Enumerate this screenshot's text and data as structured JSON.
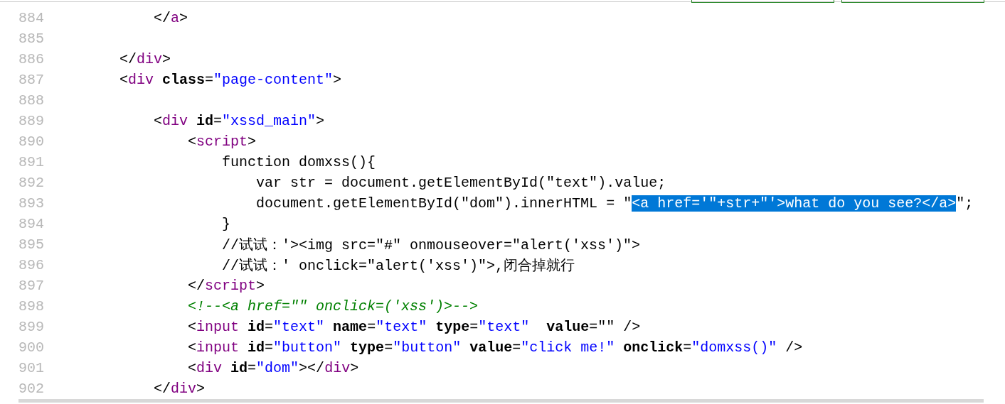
{
  "editor": {
    "lines": [
      {
        "number": "884",
        "tokens": [
          {
            "kind": "punct",
            "text": "            </"
          },
          {
            "kind": "tag",
            "text": "a"
          },
          {
            "kind": "punct",
            "text": ">"
          }
        ]
      },
      {
        "number": "885"
      },
      {
        "number": "886",
        "tokens": [
          {
            "kind": "punct",
            "text": "        </"
          },
          {
            "kind": "tag",
            "text": "div"
          },
          {
            "kind": "punct",
            "text": ">"
          }
        ]
      },
      {
        "number": "887",
        "tokens": [
          {
            "kind": "punct",
            "text": "        <"
          },
          {
            "kind": "tag",
            "text": "div"
          },
          {
            "kind": "attr",
            "text": " class"
          },
          {
            "kind": "punct",
            "text": "="
          },
          {
            "kind": "value",
            "text": "\"page-content\""
          },
          {
            "kind": "punct",
            "text": ">"
          }
        ]
      },
      {
        "number": "888"
      },
      {
        "number": "889",
        "tokens": [
          {
            "kind": "punct",
            "text": "            <"
          },
          {
            "kind": "tag",
            "text": "div"
          },
          {
            "kind": "attr",
            "text": " id"
          },
          {
            "kind": "punct",
            "text": "="
          },
          {
            "kind": "value",
            "text": "\"xssd_main\""
          },
          {
            "kind": "punct",
            "text": ">"
          }
        ]
      },
      {
        "number": "890",
        "tokens": [
          {
            "kind": "punct",
            "text": "                <"
          },
          {
            "kind": "tag",
            "text": "script"
          },
          {
            "kind": "punct",
            "text": ">"
          }
        ]
      },
      {
        "number": "891",
        "tokens": [
          {
            "kind": "text",
            "text": "                    function domxss(){"
          }
        ]
      },
      {
        "number": "892",
        "tokens": [
          {
            "kind": "text",
            "text": "                        var str = document.getElementById(\"text\").value;"
          }
        ]
      },
      {
        "number": "893",
        "tokens": [
          {
            "kind": "text",
            "text": "                        document.getElementById(\"dom\").innerHTML = \""
          },
          {
            "kind": "selection",
            "text": "<a href='\"+str+\"'>what do you see?</a>"
          },
          {
            "kind": "text",
            "text": "\";"
          }
        ]
      },
      {
        "number": "894",
        "tokens": [
          {
            "kind": "text",
            "text": "                    }"
          }
        ]
      },
      {
        "number": "895",
        "tokens": [
          {
            "kind": "text",
            "text": "                    //试试：'><img src=\"#\" onmouseover=\"alert('xss')\">"
          }
        ]
      },
      {
        "number": "896",
        "tokens": [
          {
            "kind": "text",
            "text": "                    //试试：' onclick=\"alert('xss')\">,闭合掉就行"
          }
        ]
      },
      {
        "number": "897",
        "tokens": [
          {
            "kind": "punct",
            "text": "                </"
          },
          {
            "kind": "tag",
            "text": "script"
          },
          {
            "kind": "punct",
            "text": ">"
          }
        ]
      },
      {
        "number": "898",
        "tokens": [
          {
            "kind": "comment",
            "text": "                <!--<a href=\"\" onclick=('xss')>-->"
          }
        ]
      },
      {
        "number": "899",
        "tokens": [
          {
            "kind": "punct",
            "text": "                <"
          },
          {
            "kind": "tag",
            "text": "input"
          },
          {
            "kind": "attr",
            "text": " id"
          },
          {
            "kind": "punct",
            "text": "="
          },
          {
            "kind": "value",
            "text": "\"text\""
          },
          {
            "kind": "attr",
            "text": " name"
          },
          {
            "kind": "punct",
            "text": "="
          },
          {
            "kind": "value",
            "text": "\"text\""
          },
          {
            "kind": "attr",
            "text": " type"
          },
          {
            "kind": "punct",
            "text": "="
          },
          {
            "kind": "value",
            "text": "\"text\""
          },
          {
            "kind": "attr",
            "text": "  value"
          },
          {
            "kind": "punct",
            "text": "=\"\" />"
          }
        ]
      },
      {
        "number": "900",
        "tokens": [
          {
            "kind": "punct",
            "text": "                <"
          },
          {
            "kind": "tag",
            "text": "input"
          },
          {
            "kind": "attr",
            "text": " id"
          },
          {
            "kind": "punct",
            "text": "="
          },
          {
            "kind": "value",
            "text": "\"button\""
          },
          {
            "kind": "attr",
            "text": " type"
          },
          {
            "kind": "punct",
            "text": "="
          },
          {
            "kind": "value",
            "text": "\"button\""
          },
          {
            "kind": "attr",
            "text": " value"
          },
          {
            "kind": "punct",
            "text": "="
          },
          {
            "kind": "value",
            "text": "\"click me!\""
          },
          {
            "kind": "attr",
            "text": " onclick"
          },
          {
            "kind": "punct",
            "text": "="
          },
          {
            "kind": "value",
            "text": "\"domxss()\""
          },
          {
            "kind": "punct",
            "text": " />"
          }
        ]
      },
      {
        "number": "901",
        "tokens": [
          {
            "kind": "punct",
            "text": "                <"
          },
          {
            "kind": "tag",
            "text": "div"
          },
          {
            "kind": "attr",
            "text": " id"
          },
          {
            "kind": "punct",
            "text": "="
          },
          {
            "kind": "value",
            "text": "\"dom\""
          },
          {
            "kind": "punct",
            "text": "></"
          },
          {
            "kind": "tag",
            "text": "div"
          },
          {
            "kind": "punct",
            "text": ">"
          }
        ]
      },
      {
        "number": "902",
        "tokens": [
          {
            "kind": "punct",
            "text": "            </"
          },
          {
            "kind": "tag",
            "text": "div"
          },
          {
            "kind": "punct",
            "text": ">"
          }
        ]
      }
    ]
  }
}
